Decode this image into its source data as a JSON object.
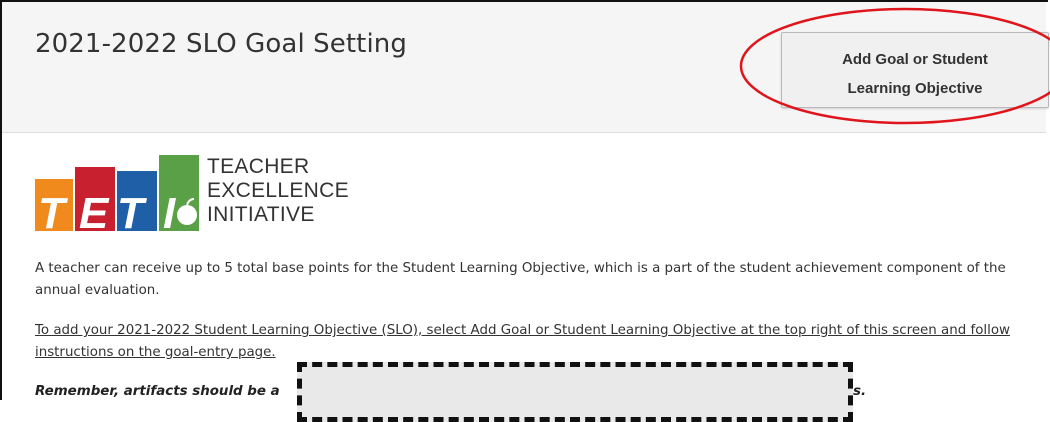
{
  "header": {
    "title": "2021-2022 SLO Goal Setting",
    "add_button_label_line1": "Add Goal or Student",
    "add_button_label_line2": "Learning Objective"
  },
  "logo": {
    "letters": [
      "T",
      "E",
      "T",
      "I"
    ],
    "text_line1": "TEACHER",
    "text_line2": "EXCELLENCE",
    "text_line3": "INITIATIVE",
    "colors": [
      "#f08a1c",
      "#c8202f",
      "#1f5fa8",
      "#5aa046"
    ]
  },
  "content": {
    "paragraph": "A teacher can receive up to 5 total base points for the Student Learning Objective, which is a part of the student achievement component of the annual evaluation.",
    "instructions": "To add your 2021-2022 Student Learning Objective (SLO), select Add Goal or Student Learning Objective at the top right of this screen and follow instructions on the goal-entry page.",
    "reminder_start": "Remember, artifacts should be a",
    "reminder_end": "s."
  },
  "annotation": {
    "circle_color": "#e0141b"
  }
}
